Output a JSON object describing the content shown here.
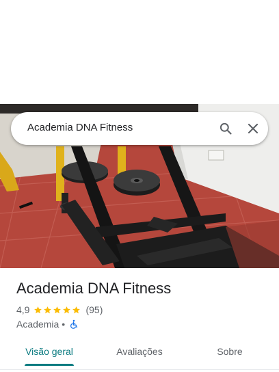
{
  "search": {
    "query": "Academia DNA Fitness"
  },
  "place": {
    "name": "Academia DNA Fitness",
    "rating": "4,9",
    "stars": 5,
    "reviews": "(95)",
    "category": "Academia",
    "separator": "•"
  },
  "tabs": [
    {
      "label": "Visão geral",
      "active": true
    },
    {
      "label": "Avaliações",
      "active": false
    },
    {
      "label": "Sobre",
      "active": false
    }
  ],
  "colors": {
    "accent": "#0b7b80",
    "star": "#fbbc04",
    "wheelchair": "#1a73e8",
    "secondary_text": "#5f6368"
  },
  "icons": {
    "search": "search-icon",
    "close": "close-icon",
    "accessibility": "wheelchair-icon"
  }
}
